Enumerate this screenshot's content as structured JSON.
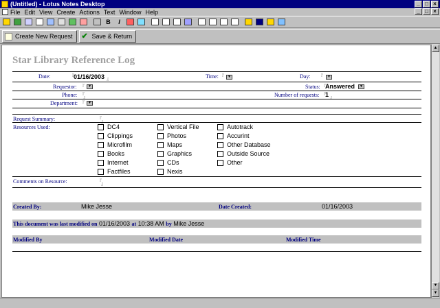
{
  "window": {
    "title": "(Untitled) - Lotus Notes Desktop"
  },
  "menu": {
    "items": [
      "File",
      "Edit",
      "View",
      "Create",
      "Actions",
      "Text",
      "Window",
      "Help"
    ]
  },
  "toolbar": {
    "icons": [
      "open-icon",
      "new-icon",
      "edit-icon",
      "mail-icon",
      "attach-icon",
      "search-icon",
      "folder-icon",
      "paperclip-icon",
      "bold-icon",
      "italic-icon",
      "pen-icon",
      "highlight-icon",
      "align-left-icon",
      "align-center-icon",
      "align-right-icon",
      "indent-icon",
      "outdent-icon",
      "bullets-icon",
      "numbers-icon",
      "spell-icon",
      "table-icon",
      "graphic-icon",
      "properties-icon"
    ],
    "bold_label": "B",
    "italic_label": "I"
  },
  "actions": {
    "create_new_request": "Create New Request",
    "save_return": "Save & Return"
  },
  "form": {
    "title": "Star Library Reference Log",
    "date_label": "Date:",
    "date_value": "01/16/2003",
    "time_label": "Time:",
    "day_label": "Day:",
    "requestor_label": "Requestor:",
    "status_label": "Status:",
    "status_value": "Answered",
    "phone_label": "Phone:",
    "num_requests_label": "Number of requests:",
    "num_requests_value": "1",
    "department_label": "Department:",
    "request_summary_label": "Request Summary:",
    "resources_label": "Resources Used:",
    "resources": [
      [
        "DC4",
        "Clippings",
        "Microfilm",
        "Books",
        "Internet",
        "Factfiles"
      ],
      [
        "Vertical File",
        "Photos",
        "Maps",
        "Graphics",
        "CDs",
        "Nexis"
      ],
      [
        "Autotrack",
        "Accurint",
        "Other Database",
        "Outside Source",
        "Other"
      ]
    ],
    "comments_label": "Comments on Resource:"
  },
  "footer": {
    "created_by_label": "Created By:",
    "created_by_value": "Mike Jesse",
    "date_created_label": "Date Created:",
    "date_created_value": "01/16/2003",
    "modified_prefix": "This document was last modified on",
    "modified_date": "01/16/2003",
    "modified_at": "at",
    "modified_time": "10:38 AM",
    "modified_by_word": "by",
    "modified_by_name": "Mike Jesse",
    "col_modified_by": "Modified By",
    "col_modified_date": "Modified Date",
    "col_modified_time": "Modified Time"
  },
  "colors": {
    "titlebar": "#000080",
    "label": "#000080",
    "chrome": "#c0c0c0",
    "title_text": "#a0a0a0"
  }
}
